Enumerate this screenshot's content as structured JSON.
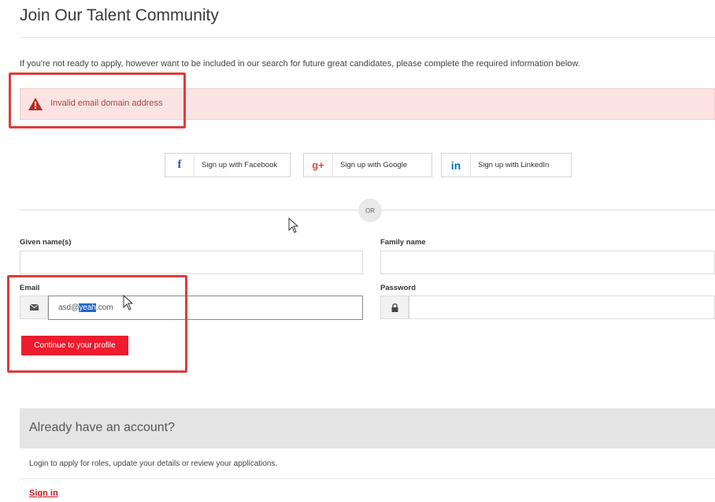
{
  "page": {
    "title": "Join Our Talent Community",
    "intro": "If you're not ready to apply, however want to be included in our search for future great candidates, please complete the required information below."
  },
  "alert": {
    "message": "Invalid email domain address",
    "icon": "warning-icon",
    "color": "#a94442",
    "background": "#fbe3e3"
  },
  "social": {
    "facebook": {
      "label": "Sign up with Facebook",
      "icon": "f"
    },
    "google": {
      "label": "Sign up with Google",
      "icon": "g+"
    },
    "linkedin": {
      "label": "Sign up with LinkedIn",
      "icon": "in"
    }
  },
  "divider": {
    "or_label": "OR"
  },
  "form": {
    "given_name": {
      "label": "Given name(s)",
      "value": ""
    },
    "family_name": {
      "label": "Family name",
      "value": ""
    },
    "email": {
      "label": "Email",
      "value_before": "asd@",
      "value_selected": "yeah",
      "value_after": ".com"
    },
    "password": {
      "label": "Password",
      "value": ""
    },
    "submit_label": "Continue to your profile",
    "accent_color": "#ed1c2e"
  },
  "account": {
    "title": "Already have an account?",
    "description": "Login to apply for roles, update your details or review your applications.",
    "signin_label": "Sign in"
  },
  "annotation_color": "#e03c3c"
}
